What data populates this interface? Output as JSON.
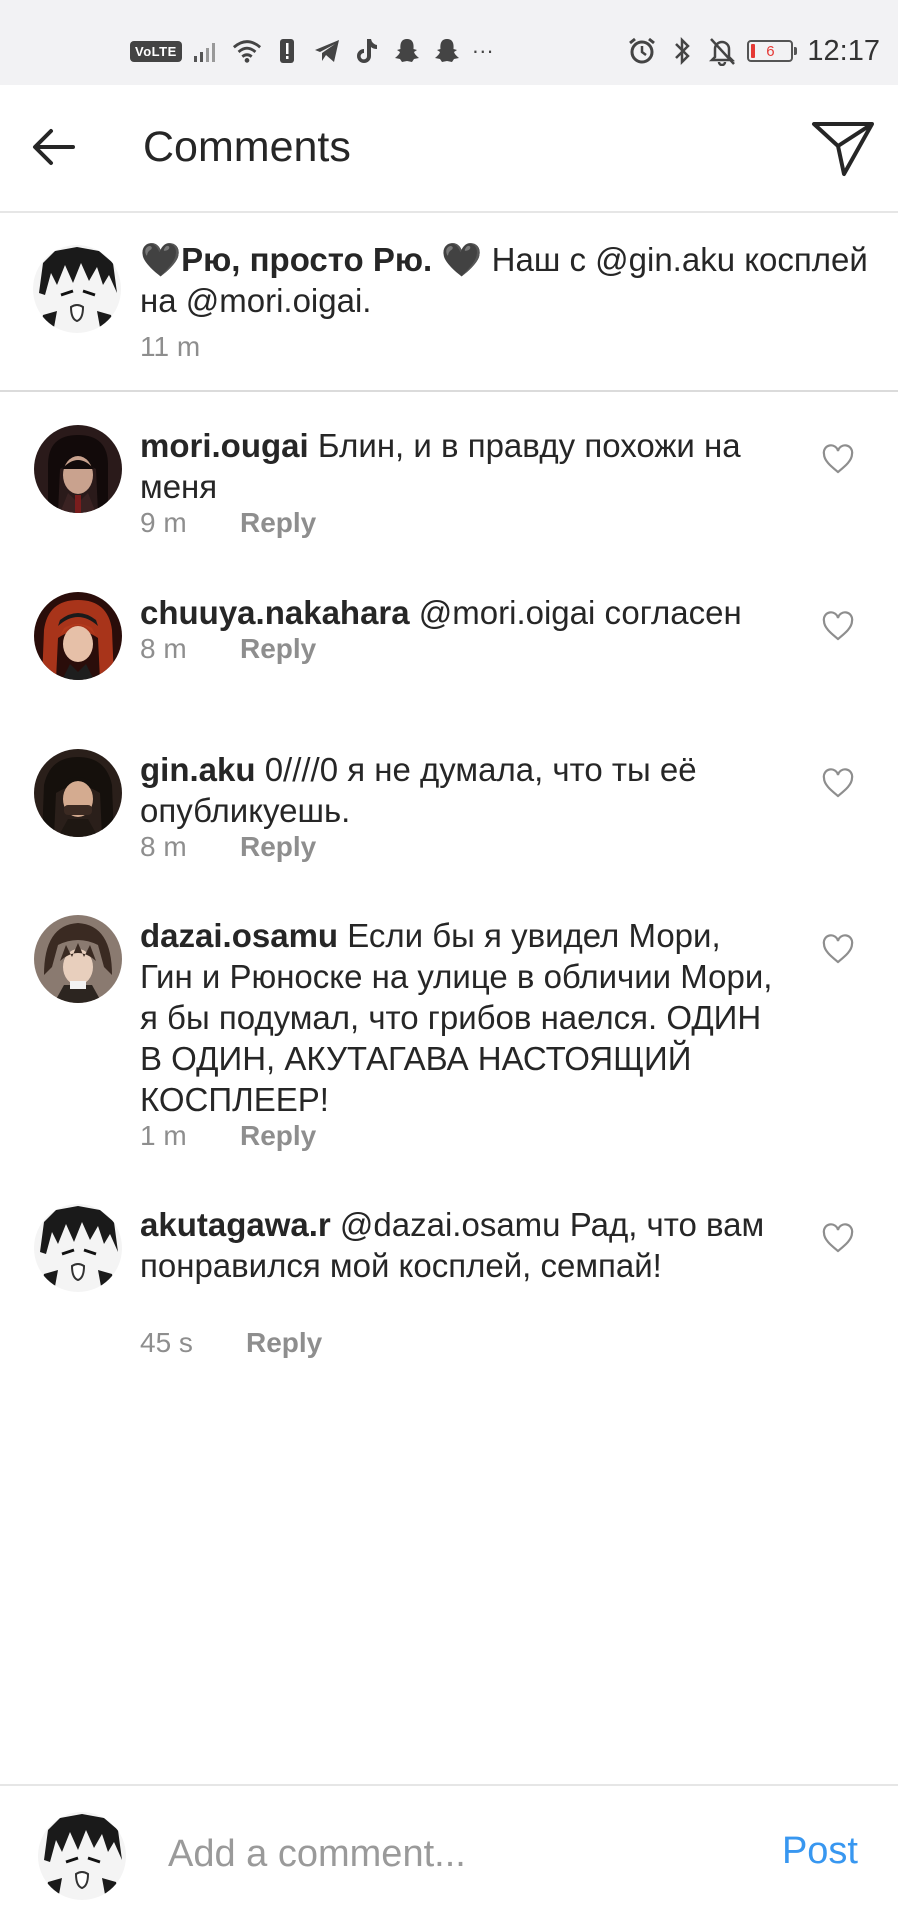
{
  "status_bar": {
    "network_badge": "VoLTE",
    "battery_level": "6",
    "time": "12:17",
    "left_icons": [
      "signal-icon",
      "wifi-icon",
      "alert-icon",
      "telegram-icon",
      "tiktok-icon",
      "snapchat-icon",
      "snapchat-icon"
    ],
    "right_icons": [
      "alarm-icon",
      "bluetooth-icon",
      "mute-icon",
      "battery-icon"
    ],
    "more_glyph": "···"
  },
  "header": {
    "title": "Comments"
  },
  "caption": {
    "heart_left": "🖤",
    "username": "Рю, просто Рю.",
    "heart_right": "🖤",
    "text": " Наш с @gin.aku косплей на @mori.oigai.",
    "time": "11 m"
  },
  "comments": [
    {
      "username": "mori.ougai",
      "text": " Блин, и в правду похожи на меня",
      "time": "9 m",
      "reply_label": "Reply"
    },
    {
      "username": "chuuya.nakahara",
      "text": " @mori.oigai согласен",
      "time": "8 m",
      "reply_label": "Reply"
    },
    {
      "username": "gin.aku",
      "text": " 0////0 я не думала, что ты её опубликуешь.",
      "time": "8 m",
      "reply_label": "Reply"
    },
    {
      "username": "dazai.osamu",
      "text": " Если бы я увидел Мори, Гин и Рюноске на улице в обличии Мори, я бы подумал, что грибов наелся. ОДИН В ОДИН, АКУТАГАВА НАСТОЯЩИЙ КОСПЛЕЕР!",
      "time": "1 m",
      "reply_label": "Reply"
    },
    {
      "username": "akutagawa.r",
      "text": " @dazai.osamu Рад, что вам понравился мой косплей, семпай!",
      "time": "45 s",
      "reply_label": "Reply"
    }
  ],
  "composer": {
    "placeholder": "Add a comment...",
    "post_label": "Post"
  },
  "colors": {
    "accent": "#3897f0",
    "muted_text": "#8e8e8e",
    "status_bar_bg": "#f2f2f4",
    "battery_low": "#e53935"
  }
}
